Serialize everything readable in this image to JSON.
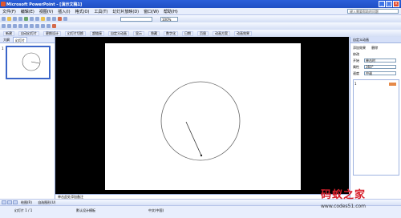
{
  "window": {
    "title": "Microsoft PowerPoint - [演示文稿1]"
  },
  "menu": {
    "items": [
      "文件(F)",
      "编辑(E)",
      "视图(V)",
      "插入(I)",
      "格式(O)",
      "工具(T)",
      "幻灯片放映(D)",
      "窗口(W)",
      "帮助(H)"
    ],
    "help_placeholder": "键入需要帮助的问题"
  },
  "toolbar": {
    "zoom": "100%",
    "buttons_row3": [
      "新建",
      "自动幻灯片",
      "更换设计",
      "幻灯片切换",
      "超链接",
      "自定义动画",
      "显示",
      "隐藏",
      "数字化",
      "日期",
      "页眉",
      "动画方案",
      "动画效果"
    ]
  },
  "left_pane": {
    "tabs": [
      "大纲",
      "幻灯片"
    ],
    "slide_number": "1"
  },
  "notes": {
    "placeholder": "单击此处添加备注"
  },
  "task_pane": {
    "title": "自定义动画",
    "add_effect": "添加效果",
    "remove": "删除",
    "modify_label": "修改",
    "start_label": "开始",
    "start_value": "单击时",
    "property_label": "属性",
    "property_value": "360°",
    "speed_label": "速度",
    "speed_value": "中速",
    "item": "1"
  },
  "status": {
    "slide": "幻灯片 1 / 1",
    "design": "默认设计模板",
    "language": "中文(中国)"
  },
  "bottom": {
    "draw_label": "绘图(R)",
    "autoshapes": "自选图形(U)"
  },
  "watermark": {
    "title": "码蚁之家",
    "url": "www.codes51.com"
  },
  "colors": {
    "title_bar": "#1f4fc4",
    "accent_orange": "#e58a4a",
    "brand_red": "#d8202c"
  }
}
